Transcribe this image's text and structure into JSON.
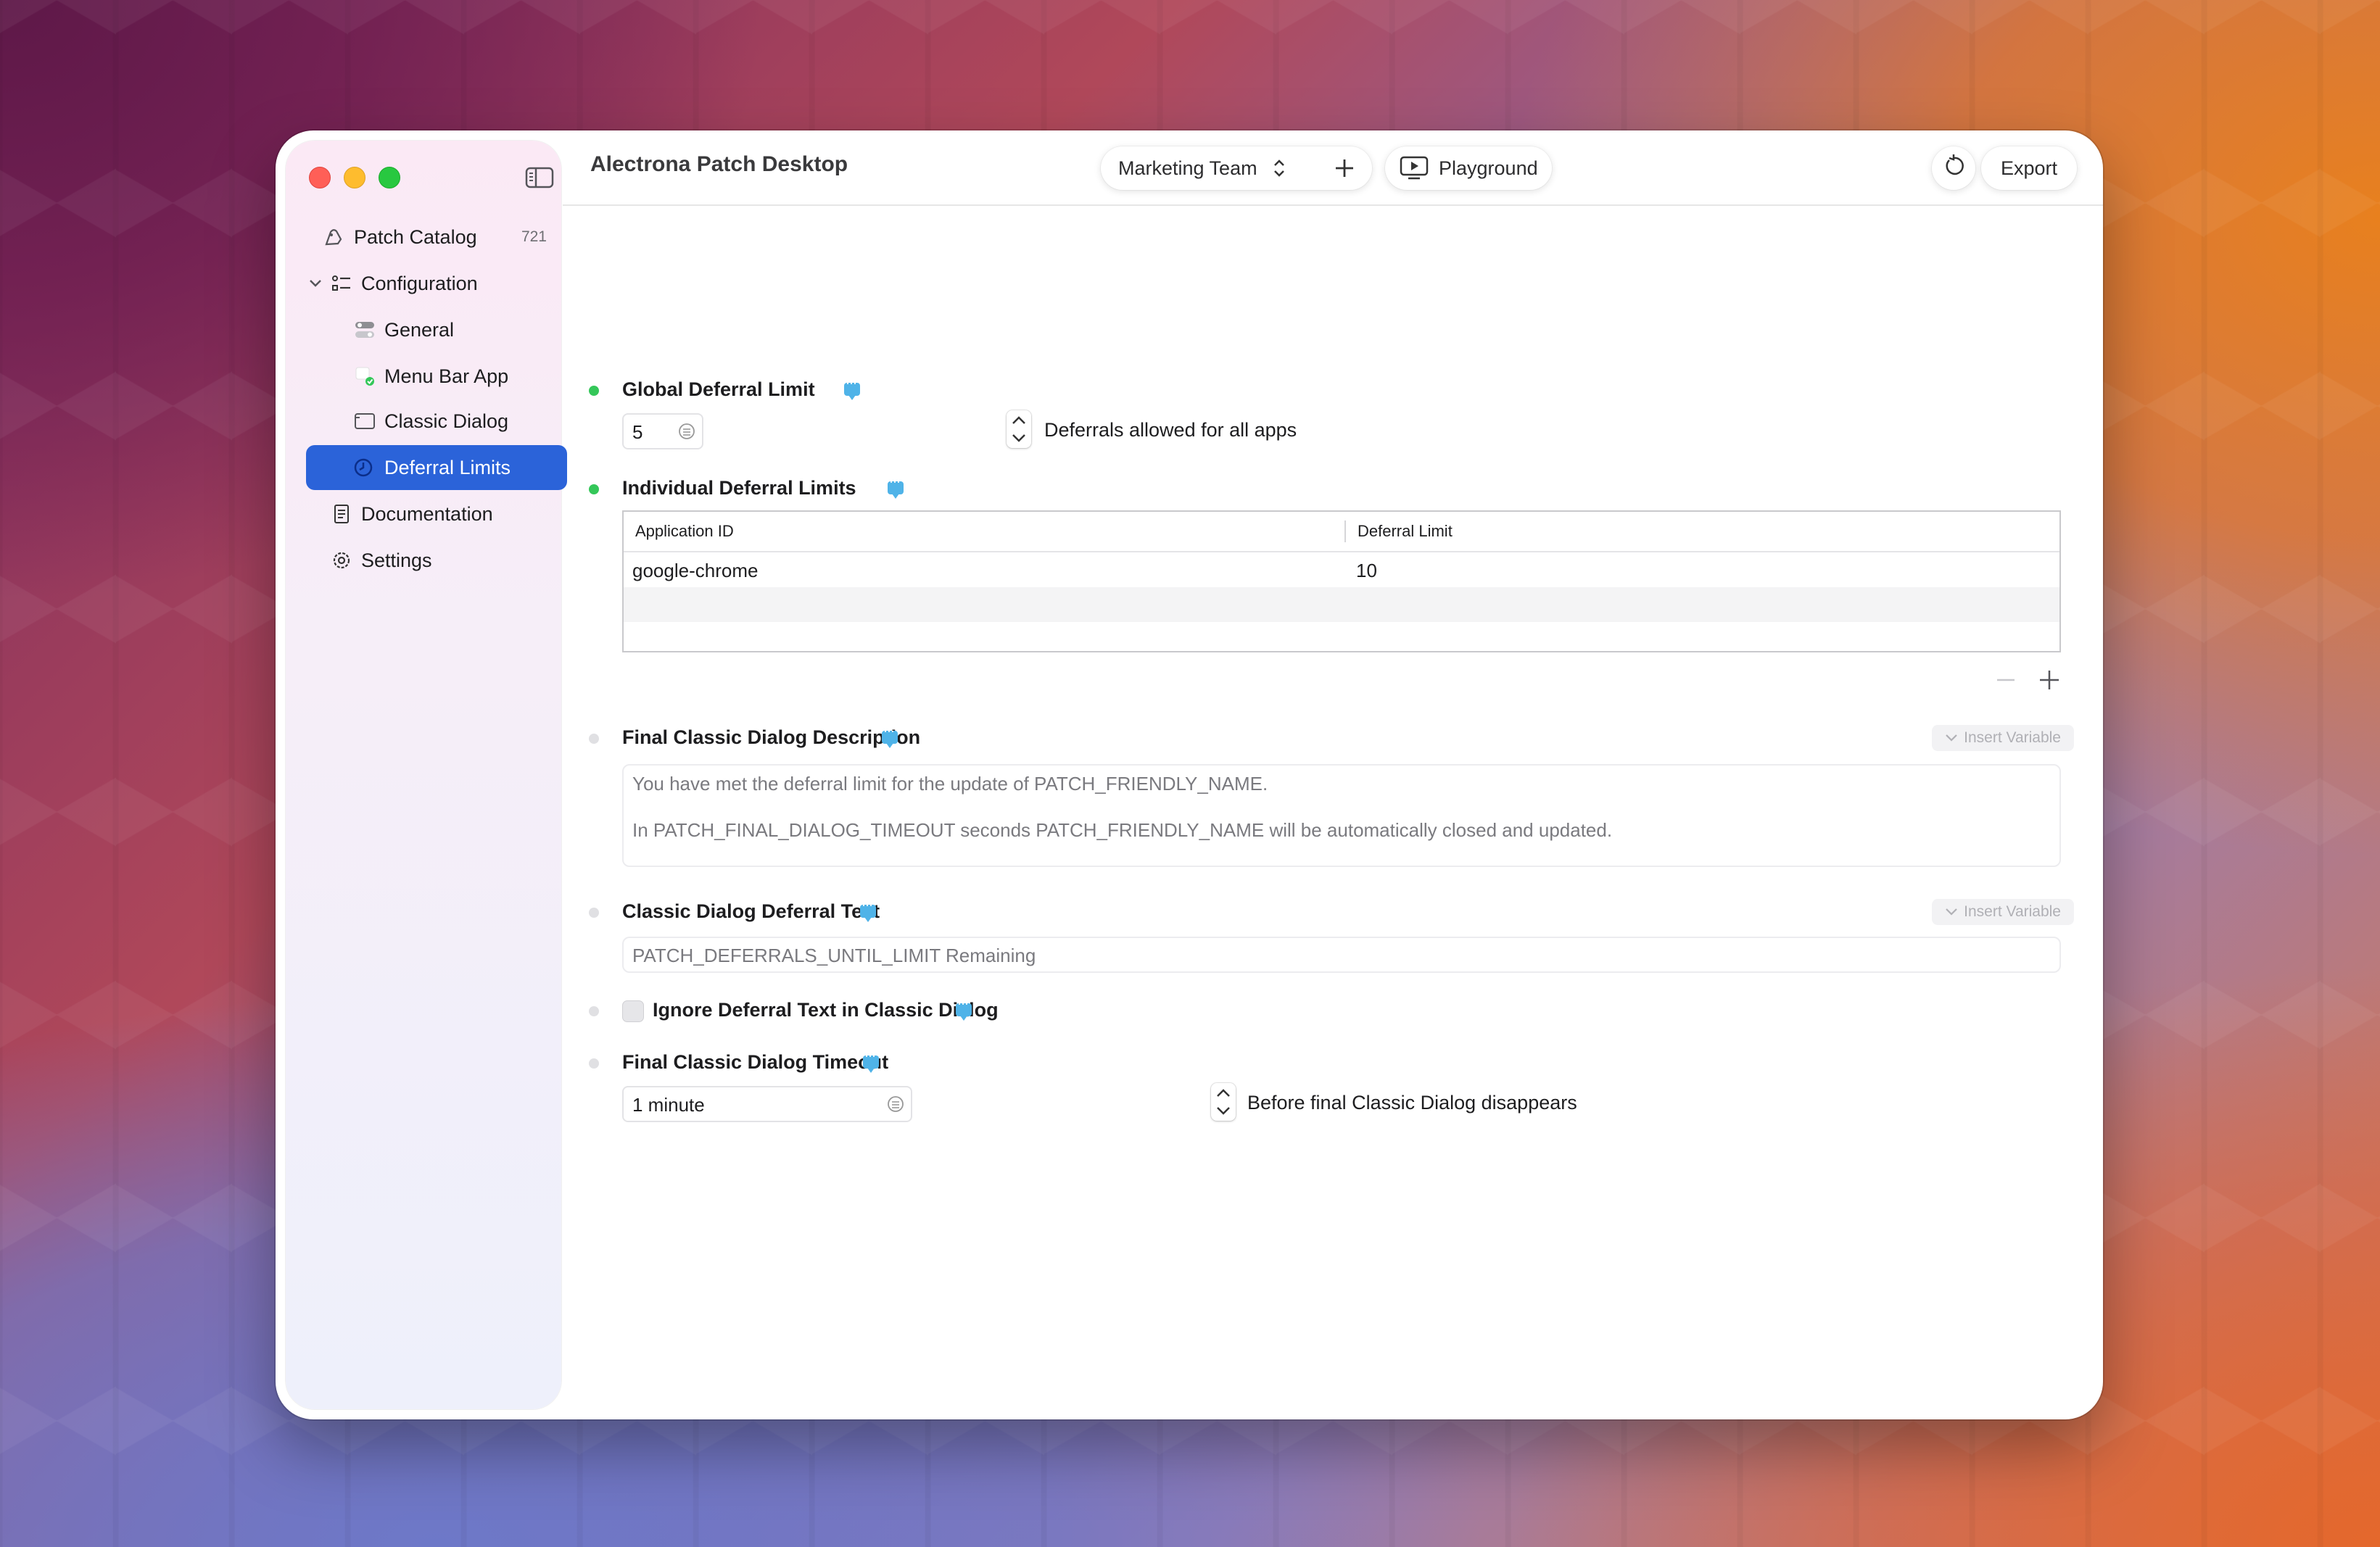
{
  "window": {
    "title": "Alectrona Patch Desktop"
  },
  "sidebar": {
    "items": [
      {
        "label": "Patch Catalog",
        "badge": "721",
        "icon": "patch-catalog-icon"
      },
      {
        "label": "Configuration",
        "icon": "configuration-list-icon",
        "expanded": true
      },
      {
        "label": "General",
        "icon": "toggles-icon"
      },
      {
        "label": "Menu Bar App",
        "icon": "menu-bar-app-icon"
      },
      {
        "label": "Classic Dialog",
        "icon": "dialog-window-icon"
      },
      {
        "label": "Deferral Limits",
        "icon": "clock-icon",
        "selected": true
      },
      {
        "label": "Documentation",
        "icon": "document-icon"
      },
      {
        "label": "Settings",
        "icon": "gear-icon"
      }
    ]
  },
  "toolbar": {
    "team_select": "Marketing Team",
    "playground_label": "Playground",
    "export_label": "Export"
  },
  "global_deferral": {
    "title": "Global Deferral Limit",
    "value": "5",
    "suffix": "Deferrals allowed for all apps"
  },
  "individual_deferral": {
    "title": "Individual Deferral Limits",
    "columns": [
      "Application ID",
      "Deferral Limit"
    ],
    "rows": [
      {
        "app_id": "google-chrome",
        "limit": "10"
      }
    ]
  },
  "final_dialog_description": {
    "title": "Final Classic Dialog Description",
    "insert_label": "Insert Variable",
    "line1": "You have met the deferral limit for the update of PATCH_FRIENDLY_NAME.",
    "line2": "In PATCH_FINAL_DIALOG_TIMEOUT seconds PATCH_FRIENDLY_NAME will be automatically closed and updated."
  },
  "deferral_text": {
    "title": "Classic Dialog Deferral Text",
    "insert_label": "Insert Variable",
    "value": "PATCH_DEFERRALS_UNTIL_LIMIT Remaining"
  },
  "ignore_deferral": {
    "title": "Ignore Deferral Text in Classic Dialog",
    "checked": false
  },
  "final_timeout": {
    "title": "Final Classic Dialog Timeout",
    "value": "1 minute",
    "suffix": "Before final Classic Dialog disappears"
  },
  "colors": {
    "accent": "#2b63d9",
    "status_green": "#34c759",
    "info_blue": "#4fb3e8"
  }
}
